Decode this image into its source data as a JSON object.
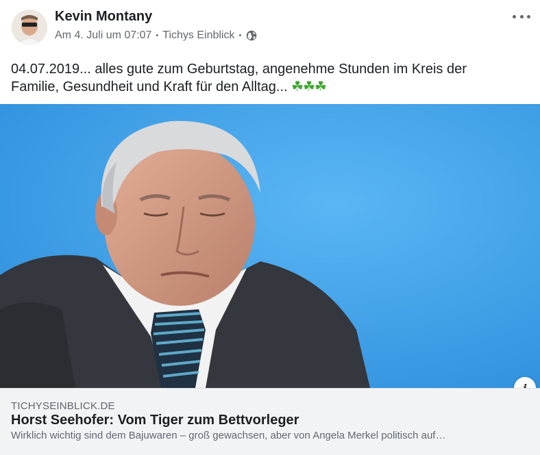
{
  "post": {
    "author": "Kevin Montany",
    "date": "Am 4. Juli um 07:07",
    "separator": "•",
    "via": "Tichys Einblick",
    "audience_icon": "globe-icon",
    "more_icon": "more-options-icon",
    "text": "04.07.2019... alles gute zum Geburtstag, angenehme Stunden im Kreis der Familie, Gesundheit und Kraft für den Alltag...",
    "emoji": "☘☘☘"
  },
  "link_preview": {
    "domain": "TICHYSEINBLICK.DE",
    "title": "Horst Seehofer: Vom Tiger zum Bettvorleger",
    "description": "Wirklich wichtig sind dem Bajuwaren – groß gewachsen, aber von Angela Merkel politisch auf…",
    "info_icon": "i"
  },
  "colors": {
    "photo_background": "#3f9fe5",
    "card_background": "#f2f3f5",
    "secondary_text": "#65676b",
    "clover": "#3aa52b"
  }
}
